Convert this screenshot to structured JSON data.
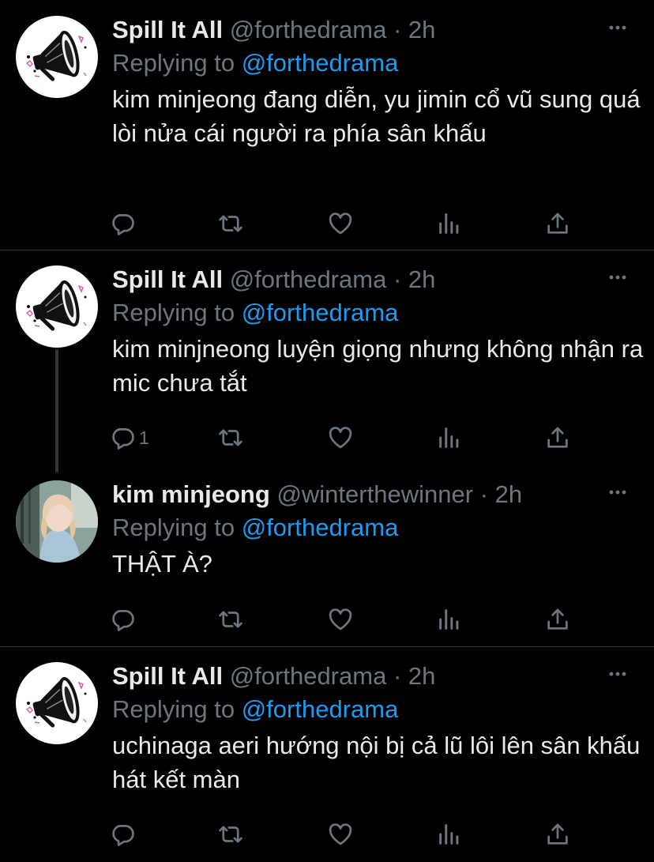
{
  "tweets": [
    {
      "name": "Spill It All",
      "handle": "@forthedrama",
      "dot": "·",
      "time": "2h",
      "replying_prefix": "Replying to",
      "replying_to": "@forthedrama",
      "text": "kim minjeong đang diễn, yu jimin cổ vũ sung quá lòi nửa cái người ra phía sân khấu",
      "reply_count": "",
      "avatar_icon": "megaphone-logo-icon"
    },
    {
      "name": "Spill It All",
      "handle": "@forthedrama",
      "dot": "·",
      "time": "2h",
      "replying_prefix": "Replying to",
      "replying_to": "@forthedrama",
      "text": "kim minjneong luyện giọng nhưng không nhận ra mic chưa tắt",
      "reply_count": "1",
      "avatar_icon": "megaphone-logo-icon"
    },
    {
      "name": "kim minjeong",
      "handle": "@winterthewinner",
      "dot": "·",
      "time": "2h",
      "replying_prefix": "Replying to",
      "replying_to": "@forthedrama",
      "text": "THẬT À?",
      "reply_count": "",
      "avatar_icon": "profile-photo"
    },
    {
      "name": "Spill It All",
      "handle": "@forthedrama",
      "dot": "·",
      "time": "2h",
      "replying_prefix": "Replying to",
      "replying_to": "@forthedrama",
      "text": "uchinaga aeri hướng nội bị cả lũ lôi lên sân khấu hát kết màn",
      "reply_count": "",
      "avatar_icon": "megaphone-logo-icon"
    }
  ],
  "colors": {
    "background": "#000000",
    "text": "#e7e9ea",
    "muted": "#6e767d",
    "link": "#1d9bf0",
    "separator": "#2f3336"
  },
  "action_icons": [
    "reply-icon",
    "retweet-icon",
    "like-icon",
    "analytics-icon",
    "share-icon"
  ]
}
